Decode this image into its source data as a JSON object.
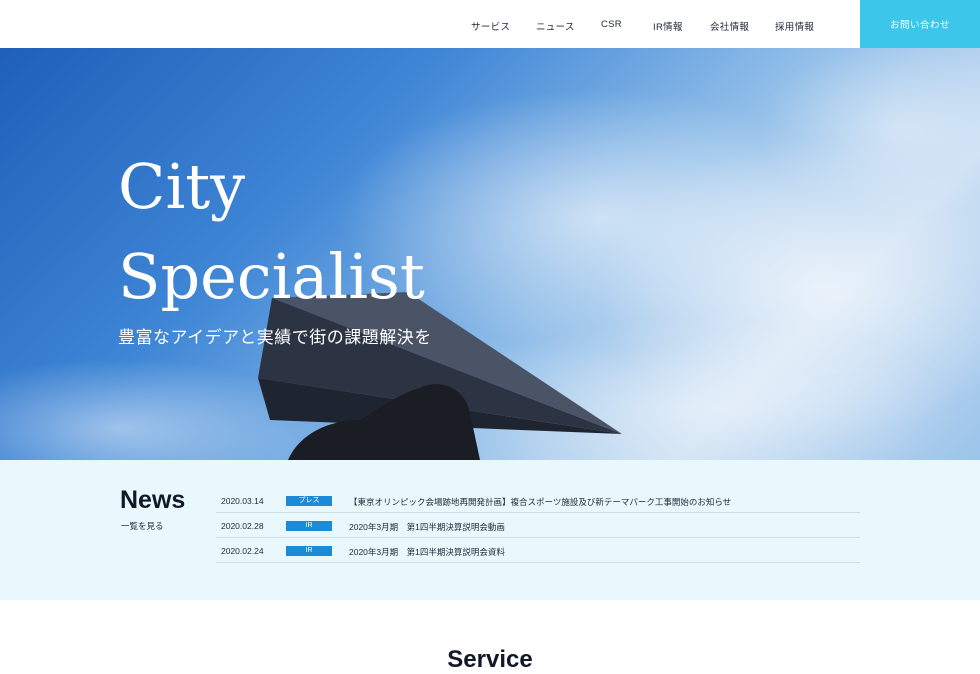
{
  "header": {
    "nav": [
      "サービス",
      "ニュース",
      "CSR",
      "IR情報",
      "会社情報",
      "採用情報"
    ],
    "contact_label": "お問い合わせ"
  },
  "hero": {
    "title_line1": "City",
    "title_line2": "Specialist",
    "subtitle": "豊富なアイデアと実績で街の課題解決を"
  },
  "news": {
    "heading": "News",
    "more_label": "一覧を見る",
    "items": [
      {
        "date": "2020.03.14",
        "category": "プレス",
        "title": "【東京オリンピック会場跡地再開発計画】複合スポーツ施設及び新テーマパーク工事開始のお知らせ"
      },
      {
        "date": "2020.02.28",
        "category": "IR",
        "title": "2020年3月期　第1四半期決算説明会動画"
      },
      {
        "date": "2020.02.24",
        "category": "IR",
        "title": "2020年3月期　第1四半期決算説明会資料"
      }
    ]
  },
  "service": {
    "heading": "Service"
  },
  "colors": {
    "accent": "#3bc6ea",
    "badge": "#1d8ad6",
    "news_bg": "#e9f8fd"
  }
}
